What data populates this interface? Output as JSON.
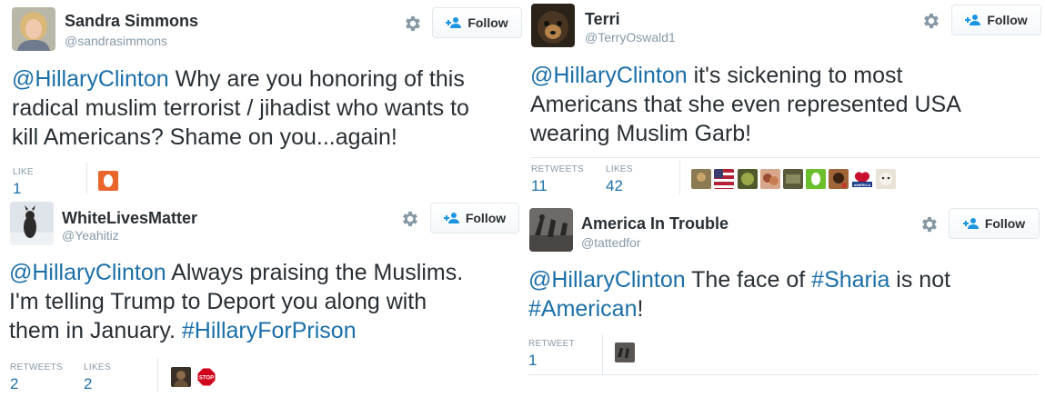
{
  "follow_label": "Follow",
  "tweets": [
    {
      "name": "Sandra Simmons",
      "handle": "@sandrasimmons",
      "lines": [
        [
          {
            "t": "@HillaryClinton",
            "c": "mention"
          },
          {
            "t": " Why are you honoring of this",
            "c": ""
          }
        ],
        [
          {
            "t": "radical muslim terrorist /  jihadist who wants to",
            "c": ""
          }
        ],
        [
          {
            "t": "kill Americans? Shame on you...again!",
            "c": ""
          }
        ]
      ],
      "stats": [
        {
          "label": "LIKE",
          "value": "1"
        }
      ]
    },
    {
      "name": "Terri",
      "handle": "@TerryOswald1",
      "lines": [
        [
          {
            "t": "@HillaryClinton",
            "c": "mention"
          },
          {
            "t": " it's sickening to most",
            "c": ""
          }
        ],
        [
          {
            "t": "Americans that she even represented USA",
            "c": ""
          }
        ],
        [
          {
            "t": "wearing Muslim Garb!",
            "c": ""
          }
        ]
      ],
      "stats": [
        {
          "label": "RETWEETS",
          "value": "11"
        },
        {
          "label": "LIKES",
          "value": "42"
        }
      ]
    },
    {
      "name": "WhiteLivesMatter",
      "handle": "@Yeahitiz",
      "lines": [
        [
          {
            "t": "@HillaryClinton",
            "c": "mention"
          },
          {
            "t": " Always praising the Muslims.",
            "c": ""
          }
        ],
        [
          {
            "t": "I'm telling Trump to Deport you along with",
            "c": ""
          }
        ],
        [
          {
            "t": "them in January.  ",
            "c": ""
          },
          {
            "t": "#HillaryForPrison",
            "c": "tag"
          }
        ]
      ],
      "stats": [
        {
          "label": "RETWEETS",
          "value": "2"
        },
        {
          "label": "LIKES",
          "value": "2"
        }
      ]
    },
    {
      "name": "America In Trouble",
      "handle": "@tattedfor",
      "lines": [
        [
          {
            "t": "@HillaryClinton",
            "c": "mention"
          },
          {
            "t": " The face of ",
            "c": ""
          },
          {
            "t": "#Sharia",
            "c": "tag"
          },
          {
            "t": " is not",
            "c": ""
          }
        ],
        [
          {
            "t": "#American",
            "c": "tag"
          },
          {
            "t": "!",
            "c": ""
          }
        ]
      ],
      "stats": [
        {
          "label": "RETWEET",
          "value": "1"
        }
      ]
    }
  ],
  "stop_sign_text": "STOP",
  "america_badge_text": "AMERICA"
}
